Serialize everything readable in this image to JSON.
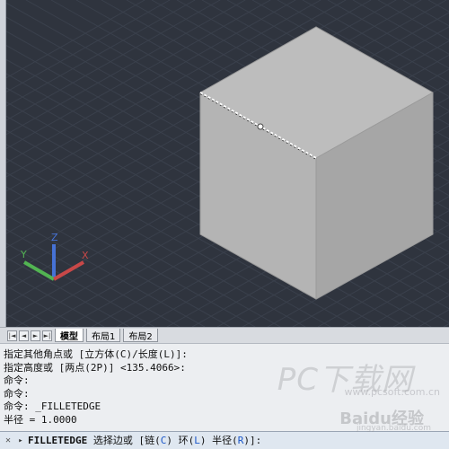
{
  "viewport": {
    "background": "#2f343e",
    "cube": {
      "top": "#bdbdbd",
      "left": "#b3b3b3",
      "right": "#a4a4a4",
      "edge_selected": "#ffffff"
    },
    "ucs": {
      "x_label": "X",
      "y_label": "Y",
      "z_label": "Z",
      "x_color": "#c84848",
      "y_color": "#52b452",
      "z_color": "#4672d6"
    }
  },
  "tabs": {
    "nav_buttons": [
      "|◄",
      "◄",
      "►",
      "►|"
    ],
    "items": [
      {
        "label": "模型",
        "active": true
      },
      {
        "label": "布局1",
        "active": false
      },
      {
        "label": "布局2",
        "active": false
      }
    ]
  },
  "command_history": [
    "指定其他角点或 [立方体(C)/长度(L)]:",
    "指定高度或 [两点(2P)] <135.4066>:",
    "命令:",
    "命令:",
    "命令: _FILLETEDGE",
    "半径 = 1.0000"
  ],
  "command_input": {
    "close_glyph": "✕",
    "prompt_glyph": "▸",
    "command": "FILLETEDGE",
    "text_before": " 选择边或 [链(",
    "opt_chain": "C",
    "text_mid1": ") 环(",
    "opt_loop": "L",
    "text_mid2": ") 半径(",
    "opt_radius": "R",
    "text_after": ")]:"
  },
  "watermark": {
    "line1": "PC下载网",
    "line2": "www.pcsoft.com.cn",
    "line3": "Baidu经验",
    "line4": "jingyan.baidu.com"
  }
}
